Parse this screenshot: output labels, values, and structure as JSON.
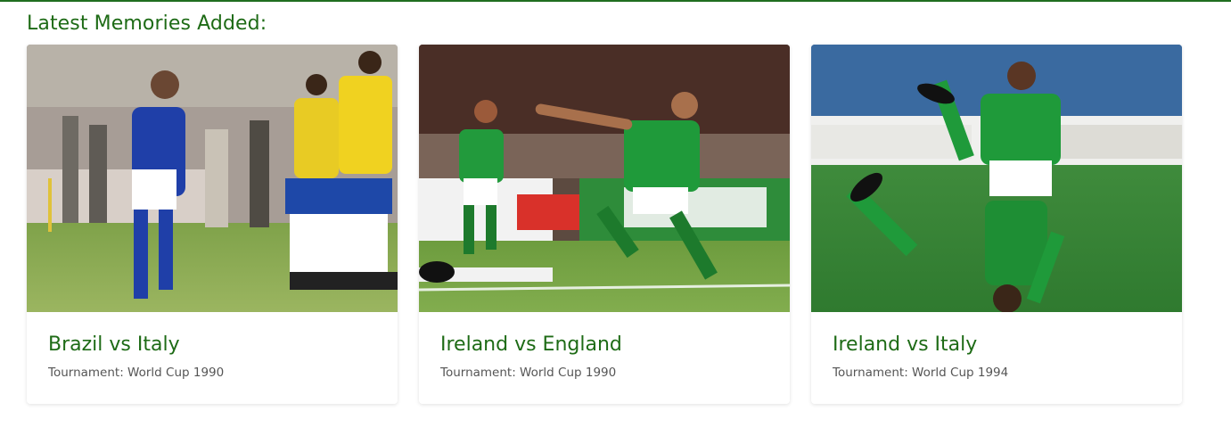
{
  "section": {
    "title": "Latest Memories Added:"
  },
  "cards": [
    {
      "title": "Brazil vs Italy",
      "subtitle": "Tournament: World Cup 1990",
      "image_icon": "photo-brazil-vs-italy"
    },
    {
      "title": "Ireland vs England",
      "subtitle": "Tournament: World Cup 1990",
      "image_icon": "photo-ireland-vs-england"
    },
    {
      "title": "Ireland vs Italy",
      "subtitle": "Tournament: World Cup 1994",
      "image_icon": "photo-ireland-vs-italy"
    }
  ],
  "colors": {
    "accent_green": "#1e6b16",
    "subtitle_gray": "#555555",
    "pitch_green": "#4f8a2e"
  }
}
